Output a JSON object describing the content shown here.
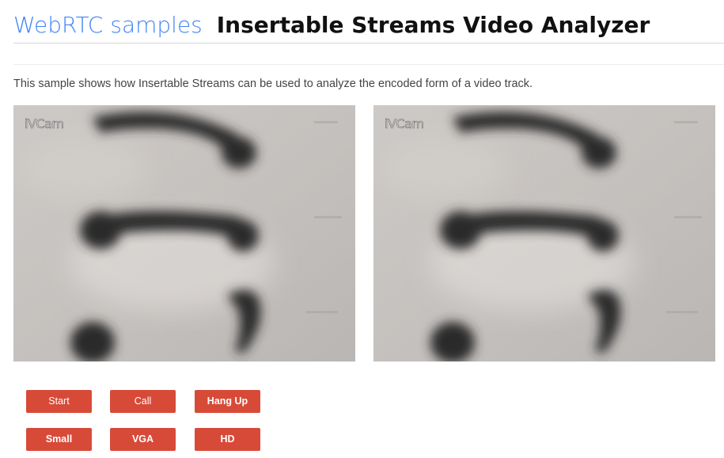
{
  "header": {
    "site_title": "WebRTC samples",
    "page_title": "Insertable Streams Video Analyzer"
  },
  "description": "This sample shows how Insertable Streams can be used to analyze the encoded form of a video track.",
  "videos": {
    "local": {
      "watermark": "iVCam"
    },
    "remote": {
      "watermark": "iVCam"
    }
  },
  "buttons": {
    "start": "Start",
    "call": "Call",
    "hangup": "Hang Up",
    "small": "Small",
    "vga": "VGA",
    "hd": "HD"
  },
  "colors": {
    "accent_blue": "#4285f4",
    "button_red": "#d84a38"
  }
}
